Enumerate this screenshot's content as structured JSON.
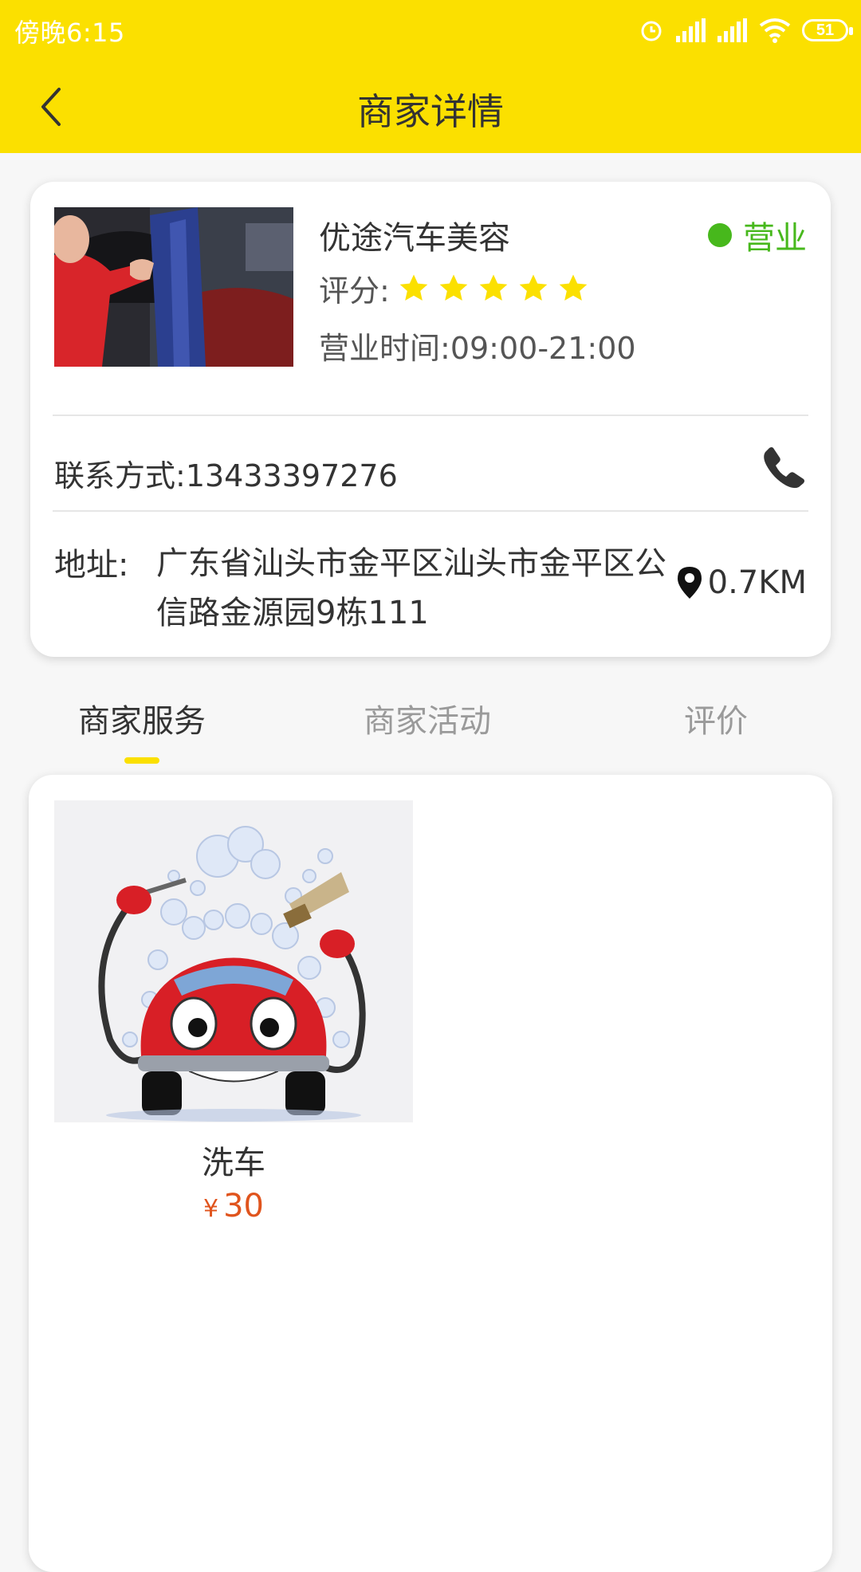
{
  "status_bar": {
    "time": "傍晚6:15",
    "battery": "51"
  },
  "header": {
    "title": "商家详情"
  },
  "merchant": {
    "name": "优途汽车美容",
    "status": "营业",
    "rating_label": "评分:",
    "rating": 5,
    "hours_label": "营业时间:",
    "hours": "09:00-21:00",
    "contact_label": "联系方式:",
    "contact": "13433397276",
    "address_label": "地址:",
    "address": "广东省汕头市金平区汕头市金平区公信路金源园9栋111",
    "distance": "0.7KM"
  },
  "tabs": [
    {
      "label": "商家服务",
      "active": true
    },
    {
      "label": "商家活动",
      "active": false
    },
    {
      "label": "评价",
      "active": false
    }
  ],
  "services": [
    {
      "name": "洗车",
      "currency": "¥",
      "price": "30"
    }
  ],
  "colors": {
    "accent_yellow": "#fbe000",
    "open_green": "#47b81c",
    "price_red": "#e0541d"
  }
}
